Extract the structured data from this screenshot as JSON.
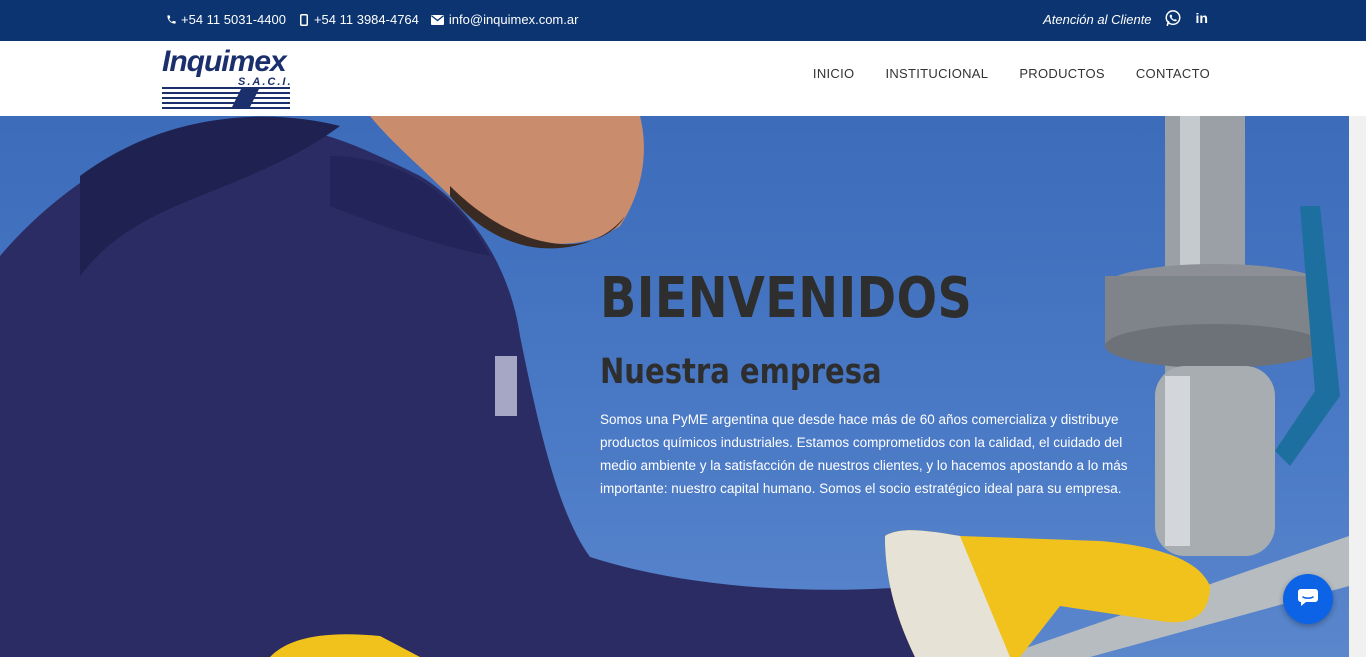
{
  "topbar": {
    "phone1": "+54 11 5031-4400",
    "phone2": "+54 11 3984-4764",
    "email": "info@inquimex.com.ar",
    "atencion": "Atención al Cliente",
    "linkedin": "in"
  },
  "logo": {
    "brand": "Inquimex",
    "suffix": "S.A.C.I."
  },
  "nav": {
    "items": [
      "INICIO",
      "INSTITUCIONAL",
      "PRODUCTOS",
      "CONTACTO"
    ]
  },
  "hero": {
    "title": "BIENVENIDOS",
    "subtitle": "Nuestra empresa",
    "body": "Somos una PyME argentina que desde hace más de 60 años comercializa y distribuye productos químicos industriales. Estamos comprometidos con la calidad, el cuidado del medio ambiente y la satisfacción de nuestros clientes, y lo hacemos apostando a lo más importante: nuestro capital humano. Somos el socio estratégico ideal para su empresa."
  },
  "icons": {
    "phone": "phone-icon",
    "mobile": "mobile-icon",
    "email": "envelope-icon",
    "whatsapp": "whatsapp-icon",
    "chat": "chat-icon"
  },
  "colors": {
    "topbar": "#0b3470",
    "brand": "#1b2f6d",
    "chat": "#0d63e6"
  }
}
